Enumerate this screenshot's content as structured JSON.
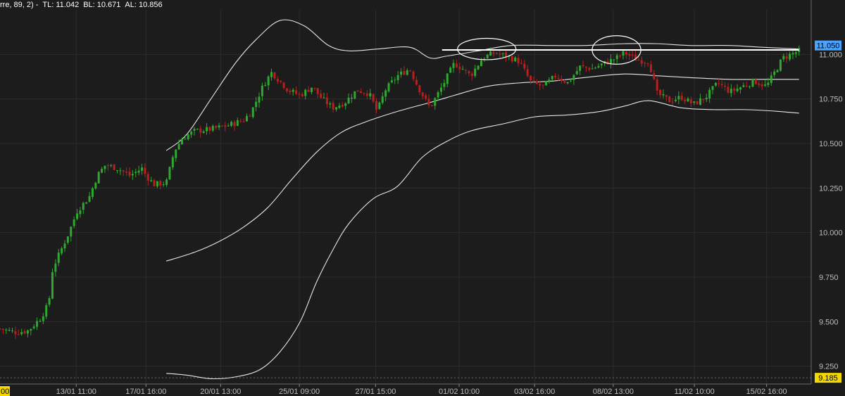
{
  "legend": {
    "prefix": "rre, 89, 2) -",
    "tl": "TL: 11.042",
    "bl": "BL: 10.671",
    "al": "AL: 10.856"
  },
  "price_tags": {
    "last": {
      "label": "11.050",
      "value": 11.05,
      "bg": "#4aa3ff",
      "fg": "#000000"
    },
    "low": {
      "label": "9.185",
      "value": 9.185,
      "bg": "#f5d800",
      "fg": "#000000"
    },
    "bottom_left_partial": "00"
  },
  "colors": {
    "background": "#1c1c1c",
    "grid": "#2c2c2c",
    "up": "#2ea82e",
    "down": "#b81f1f",
    "bands": "#e6e6e6",
    "axis_text": "#bdbdbd"
  },
  "chart_data": {
    "type": "candlestick",
    "title": "",
    "ylim": [
      9.15,
      11.25
    ],
    "y_ticks": [
      9.25,
      9.5,
      9.75,
      10.0,
      10.25,
      10.5,
      10.75,
      11.0
    ],
    "y_tick_labels": [
      "9.250",
      "9.500",
      "9.750",
      "10.000",
      "10.250",
      "10.500",
      "10.750",
      "11.000"
    ],
    "x_tick_labels": [
      "13/01 11:00",
      "17/01 16:00",
      "20/01 13:00",
      "25/01 09:00",
      "27/01 15:00",
      "01/02 10:00",
      "03/02 16:00",
      "08/02 13:00",
      "11/02 10:00",
      "15/02 16:00"
    ],
    "x_tick_positions": [
      0.094,
      0.18,
      0.272,
      0.369,
      0.463,
      0.566,
      0.659,
      0.756,
      0.856,
      0.945
    ],
    "anchors": [
      [
        0.0,
        9.46
      ],
      [
        0.02,
        9.44
      ],
      [
        0.035,
        9.45
      ],
      [
        0.05,
        9.52
      ],
      [
        0.06,
        9.6
      ],
      [
        0.065,
        9.8
      ],
      [
        0.075,
        9.9
      ],
      [
        0.085,
        10.0
      ],
      [
        0.095,
        10.12
      ],
      [
        0.11,
        10.2
      ],
      [
        0.12,
        10.32
      ],
      [
        0.13,
        10.38
      ],
      [
        0.145,
        10.36
      ],
      [
        0.16,
        10.32
      ],
      [
        0.175,
        10.36
      ],
      [
        0.18,
        10.32
      ],
      [
        0.19,
        10.27
      ],
      [
        0.205,
        10.28
      ],
      [
        0.215,
        10.46
      ],
      [
        0.225,
        10.53
      ],
      [
        0.24,
        10.57
      ],
      [
        0.26,
        10.58
      ],
      [
        0.28,
        10.6
      ],
      [
        0.3,
        10.63
      ],
      [
        0.31,
        10.68
      ],
      [
        0.325,
        10.83
      ],
      [
        0.335,
        10.9
      ],
      [
        0.345,
        10.85
      ],
      [
        0.355,
        10.8
      ],
      [
        0.37,
        10.77
      ],
      [
        0.385,
        10.82
      ],
      [
        0.395,
        10.76
      ],
      [
        0.41,
        10.7
      ],
      [
        0.425,
        10.73
      ],
      [
        0.44,
        10.8
      ],
      [
        0.455,
        10.78
      ],
      [
        0.465,
        10.68
      ],
      [
        0.475,
        10.8
      ],
      [
        0.49,
        10.88
      ],
      [
        0.505,
        10.92
      ],
      [
        0.515,
        10.82
      ],
      [
        0.53,
        10.7
      ],
      [
        0.545,
        10.82
      ],
      [
        0.56,
        10.95
      ],
      [
        0.57,
        10.92
      ],
      [
        0.58,
        10.88
      ],
      [
        0.595,
        10.98
      ],
      [
        0.61,
        11.01
      ],
      [
        0.625,
        10.99
      ],
      [
        0.64,
        10.96
      ],
      [
        0.655,
        10.84
      ],
      [
        0.67,
        10.82
      ],
      [
        0.685,
        10.88
      ],
      [
        0.7,
        10.84
      ],
      [
        0.715,
        10.93
      ],
      [
        0.73,
        10.92
      ],
      [
        0.745,
        10.95
      ],
      [
        0.76,
        10.98
      ],
      [
        0.77,
        11.01
      ],
      [
        0.785,
        10.97
      ],
      [
        0.8,
        10.96
      ],
      [
        0.81,
        10.78
      ],
      [
        0.825,
        10.74
      ],
      [
        0.84,
        10.76
      ],
      [
        0.855,
        10.72
      ],
      [
        0.87,
        10.76
      ],
      [
        0.885,
        10.84
      ],
      [
        0.9,
        10.79
      ],
      [
        0.915,
        10.82
      ],
      [
        0.93,
        10.85
      ],
      [
        0.945,
        10.82
      ],
      [
        0.955,
        10.9
      ],
      [
        0.965,
        10.98
      ],
      [
        0.975,
        11.0
      ],
      [
        0.985,
        11.02
      ]
    ],
    "bands": {
      "upper": [
        [
          0.205,
          10.46
        ],
        [
          0.23,
          10.55
        ],
        [
          0.26,
          10.75
        ],
        [
          0.29,
          10.95
        ],
        [
          0.315,
          11.08
        ],
        [
          0.345,
          11.19
        ],
        [
          0.375,
          11.16
        ],
        [
          0.405,
          11.05
        ],
        [
          0.43,
          11.02
        ],
        [
          0.465,
          11.03
        ],
        [
          0.505,
          11.04
        ],
        [
          0.53,
          10.98
        ],
        [
          0.55,
          10.99
        ],
        [
          0.59,
          11.02
        ],
        [
          0.63,
          11.05
        ],
        [
          0.68,
          11.05
        ],
        [
          0.72,
          11.05
        ],
        [
          0.77,
          11.06
        ],
        [
          0.81,
          11.06
        ],
        [
          0.85,
          11.05
        ],
        [
          0.9,
          11.05
        ],
        [
          0.94,
          11.04
        ],
        [
          0.985,
          11.03
        ]
      ],
      "middle": [
        [
          0.205,
          9.84
        ],
        [
          0.24,
          9.89
        ],
        [
          0.27,
          9.95
        ],
        [
          0.3,
          10.03
        ],
        [
          0.33,
          10.14
        ],
        [
          0.36,
          10.3
        ],
        [
          0.39,
          10.45
        ],
        [
          0.42,
          10.56
        ],
        [
          0.45,
          10.62
        ],
        [
          0.49,
          10.68
        ],
        [
          0.53,
          10.73
        ],
        [
          0.56,
          10.77
        ],
        [
          0.6,
          10.82
        ],
        [
          0.64,
          10.84
        ],
        [
          0.68,
          10.85
        ],
        [
          0.72,
          10.87
        ],
        [
          0.77,
          10.89
        ],
        [
          0.81,
          10.88
        ],
        [
          0.85,
          10.87
        ],
        [
          0.9,
          10.86
        ],
        [
          0.94,
          10.86
        ],
        [
          0.985,
          10.86
        ]
      ],
      "lower": [
        [
          0.205,
          9.21
        ],
        [
          0.23,
          9.2
        ],
        [
          0.26,
          9.18
        ],
        [
          0.29,
          9.19
        ],
        [
          0.32,
          9.23
        ],
        [
          0.345,
          9.33
        ],
        [
          0.37,
          9.5
        ],
        [
          0.39,
          9.72
        ],
        [
          0.41,
          9.9
        ],
        [
          0.43,
          10.05
        ],
        [
          0.46,
          10.19
        ],
        [
          0.49,
          10.26
        ],
        [
          0.52,
          10.42
        ],
        [
          0.55,
          10.51
        ],
        [
          0.58,
          10.57
        ],
        [
          0.62,
          10.61
        ],
        [
          0.66,
          10.65
        ],
        [
          0.7,
          10.66
        ],
        [
          0.74,
          10.68
        ],
        [
          0.77,
          10.71
        ],
        [
          0.8,
          10.74
        ],
        [
          0.84,
          10.7
        ],
        [
          0.88,
          10.69
        ],
        [
          0.92,
          10.69
        ],
        [
          0.96,
          10.68
        ],
        [
          0.985,
          10.67
        ]
      ]
    },
    "resistance_line": {
      "from": 0.545,
      "to": 0.985,
      "value": 11.025
    },
    "highlight_ellipses": [
      {
        "center": 0.6,
        "value": 11.03,
        "rx": 0.036,
        "ry": 0.06
      },
      {
        "center": 0.76,
        "value": 11.025,
        "rx": 0.03,
        "ry": 0.08
      }
    ],
    "low_reference": 9.185,
    "candle_count": 260
  }
}
